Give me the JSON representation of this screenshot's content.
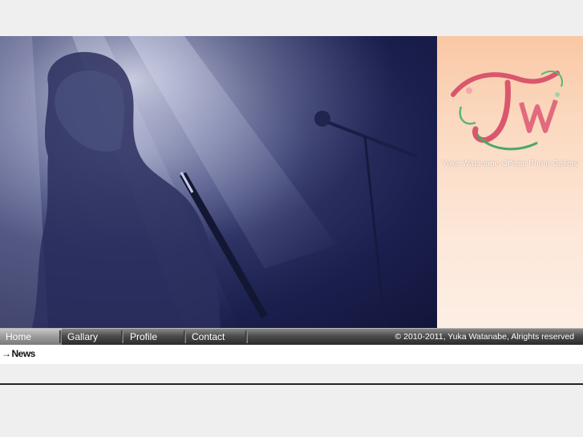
{
  "brand": {
    "tagline": "Yuka Watanabe Official Photo Gallery",
    "logo_text": "Yw"
  },
  "nav": {
    "items": [
      {
        "label": "Home",
        "active": true
      },
      {
        "label": "Gallary",
        "active": false
      },
      {
        "label": "Profile",
        "active": false
      },
      {
        "label": "Contact",
        "active": false
      }
    ],
    "copyright": "© 2010-2011, Yuka Watanabe, Alrights reserved"
  },
  "news": {
    "arrow": "→",
    "label": "News"
  },
  "colors": {
    "page_bg": "#efefef",
    "photo_blue": "#1b1f4d",
    "brand_peach": "#f9c8a5",
    "logo_pink": "#e0667a",
    "logo_green": "#4aa86a"
  }
}
